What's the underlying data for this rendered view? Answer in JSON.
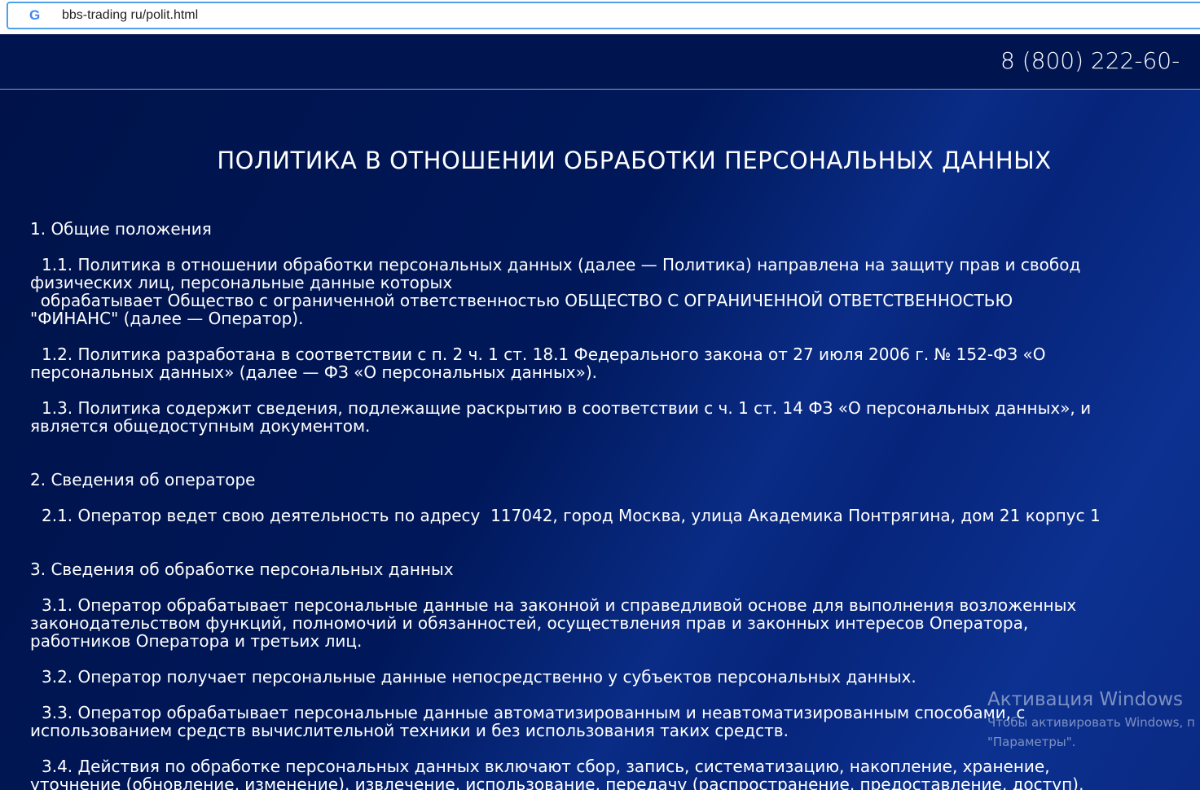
{
  "browser": {
    "url": "bbs-trading ru/polit.html",
    "icon": "google-icon"
  },
  "header": {
    "phone": "8 (800) 222-60-"
  },
  "title": "ПОЛИТИКА В ОТНОШЕНИИ ОБРАБОТКИ ПЕРСОНАЛЬНЫХ ДАННЫХ",
  "sections": [
    {
      "heading": "1. Общие положения",
      "paragraphs": [
        [
          "1.1. Политика в отношении обработки персональных данных (далее — Политика) направлена на защиту прав и свобод",
          "физических лиц, персональные данные которых",
          "  обрабатывает Общество с ограниченной ответственностью ОБЩЕСТВО С ОГРАНИЧЕННОЙ ОТВЕТСТВЕННОСТЬЮ",
          "\"ФИНАНС\" (далее — Оператор)."
        ],
        [
          "1.2. Политика разработана в соответствии с п. 2 ч. 1 ст. 18.1 Федерального закона от 27 июля 2006 г. № 152-ФЗ «О",
          "персональных данных» (далее — ФЗ «О персональных данных»)."
        ],
        [
          "1.3. Политика содержит сведения, подлежащие раскрытию в соответствии с ч. 1 ст. 14 ФЗ «О персональных данных», и",
          "является общедоступным документом."
        ]
      ]
    },
    {
      "heading": "2. Сведения об операторе",
      "paragraphs": [
        [
          "2.1. Оператор ведет свою деятельность по адресу  117042, город Москва, улица Академика Понтрягина, дом 21 корпус 1"
        ]
      ]
    },
    {
      "heading": "3. Сведения об обработке персональных данных",
      "paragraphs": [
        [
          "3.1. Оператор обрабатывает персональные данные на законной и справедливой основе для выполнения возложенных",
          "законодательством функций, полномочий и обязанностей, осуществления прав и законных интересов Оператора,",
          "работников Оператора и третьих лиц."
        ],
        [
          "3.2. Оператор получает персональные данные непосредственно у субъектов персональных данных."
        ],
        [
          "3.3. Оператор обрабатывает персональные данные автоматизированным и неавтоматизированным способами, с",
          "использованием средств вычислительной техники и без использования таких средств."
        ],
        [
          "3.4. Действия по обработке персональных данных включают сбор, запись, систематизацию, накопление, хранение,",
          "уточнение (обновление, изменение), извлечение, использование, передачу (распространение, предоставление, доступ),"
        ]
      ]
    }
  ],
  "watermark": {
    "title": "Активация Windows",
    "line1": "Чтобы активировать Windows, п",
    "line2": "\"Параметры\"."
  }
}
